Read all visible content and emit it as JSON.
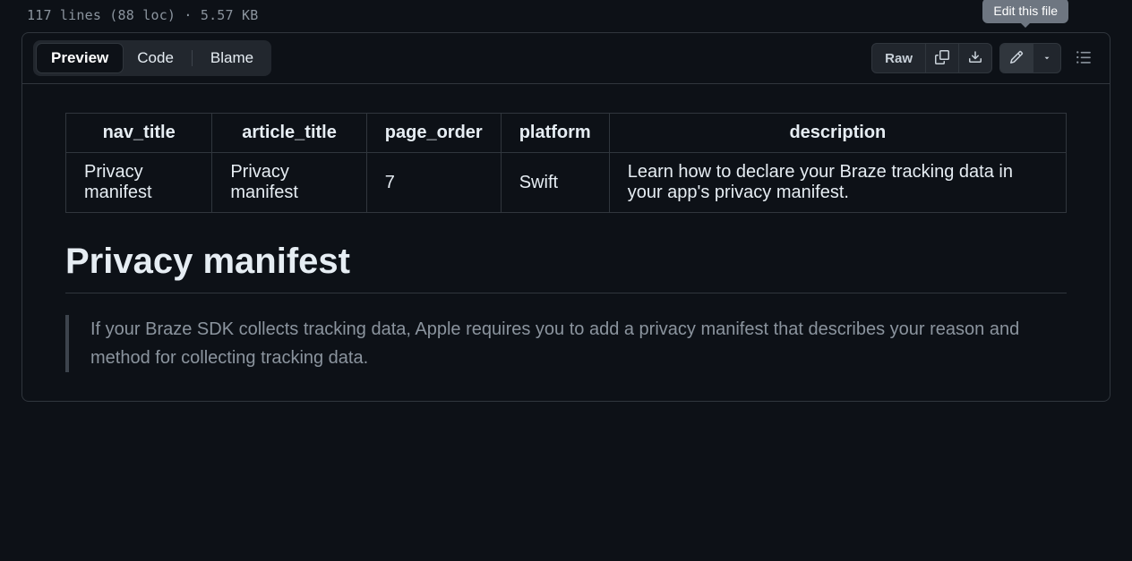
{
  "file_info": "117 lines (88 loc) · 5.57 KB",
  "tabs": {
    "preview": "Preview",
    "code": "Code",
    "blame": "Blame"
  },
  "toolbar": {
    "raw": "Raw",
    "tooltip": "Edit this file"
  },
  "table": {
    "headers": [
      "nav_title",
      "article_title",
      "page_order",
      "platform",
      "description"
    ],
    "row": {
      "nav_title": "Privacy manifest",
      "article_title": "Privacy manifest",
      "page_order": "7",
      "platform": "Swift",
      "description": "Learn how to declare your Braze tracking data in your app's privacy manifest."
    }
  },
  "article": {
    "heading": "Privacy manifest",
    "intro": "If your Braze SDK collects tracking data, Apple requires you to add a privacy manifest that describes your reason and method for collecting tracking data."
  }
}
